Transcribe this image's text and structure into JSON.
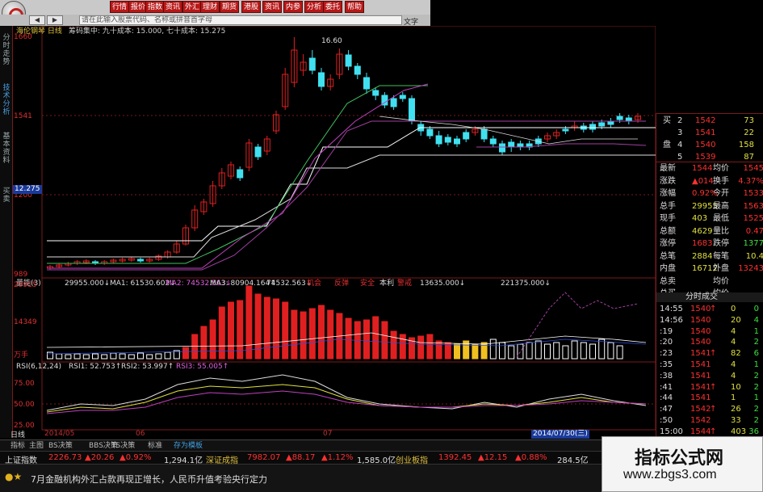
{
  "toolbar": {
    "buttons": [
      "行情",
      "报价",
      "指数",
      "资讯",
      "外汇",
      "理财",
      "期货",
      "港股",
      "资讯",
      "内参",
      "分析",
      "委托",
      "帮助"
    ]
  },
  "searchbar": {
    "input_text": "请在此输入股票代码、名称或拼音首字母",
    "font_label": "文字"
  },
  "sidetabs": [
    "分时走势",
    "技术分析",
    "基本资料",
    "买卖"
  ],
  "chart": {
    "stock_label": "海伦钢琴 日线",
    "cost_text": "筹码集中: 九十成本: 15.000, 七十成本: 15.275",
    "price_axis": [
      "1660",
      "1541",
      "1200",
      "989"
    ],
    "price_marker": "12.275",
    "high_label": "16.60",
    "volume_header": [
      "量能(3)",
      "29955.000↓",
      "MA1: 61530.602↓",
      "MA2: 74532.563↓",
      "MA3: 80904.164↑",
      "74532.563↓",
      "机会",
      "反弹",
      "安全",
      "本利",
      "警戒",
      "13635.000↓",
      "221375.000↓"
    ],
    "volume_axis": [
      "29915",
      "14349",
      "万手"
    ],
    "rsi_header": [
      "RSI(6,12,24)",
      "RSI1: 52.753↑",
      "RSI2: 53.997↑",
      "RSI3: 55.005↑"
    ],
    "rsi_axis": [
      "75.00",
      "50.00",
      "25.00"
    ],
    "x_labels": [
      "2014/05",
      "06",
      "07"
    ],
    "date_box": "2014/07/30(三)",
    "colors": {
      "up": "#e02020",
      "down": "#40e0f0",
      "yellow": "#f0c020",
      "ma_white": "#ffffff",
      "ma_green": "#40c060",
      "ma_magenta": "#c040c0"
    }
  },
  "quote": {
    "bids": [
      {
        "side": "买",
        "level": "2",
        "price": "1542",
        "vol": "73"
      },
      {
        "side": "",
        "level": "3",
        "price": "1541",
        "vol": "22"
      },
      {
        "side": "盘",
        "level": "4",
        "price": "1540",
        "vol": "158"
      },
      {
        "side": "",
        "level": "5",
        "price": "1539",
        "vol": "87"
      }
    ],
    "stats": [
      {
        "k1": "最新",
        "v1": "1544",
        "k2": "均价",
        "v2": "1545"
      },
      {
        "k1": "涨跌",
        "v1": "▲014",
        "k2": "换手",
        "v2": "4.37%"
      },
      {
        "k1": "涨幅",
        "v1": "0.92%",
        "k2": "今开",
        "v2": "1533"
      },
      {
        "k1": "总手",
        "v1": "29955",
        "k2": "最高",
        "v2": "1563"
      },
      {
        "k1": "现手",
        "v1": "403",
        "k2": "最低",
        "v2": "1525"
      },
      {
        "k1": "总额",
        "v1": "4629",
        "k2": "量比",
        "v2": "0.47"
      },
      {
        "k1": "涨停",
        "v1": "1683",
        "k2": "跌停",
        "v2": "1377"
      },
      {
        "k1": "总笔",
        "v1": "2884",
        "k2": "每笔",
        "v2": "10.4"
      },
      {
        "k1": "内盘",
        "v1": "16712",
        "k2": "外盘",
        "v2": "13243"
      },
      {
        "k1": "总卖",
        "v1": "",
        "k2": "均价",
        "v2": ""
      },
      {
        "k1": "总买",
        "v1": "",
        "k2": "均价",
        "v2": ""
      }
    ],
    "tick_header": "分时成交",
    "ticks": [
      {
        "time": "14:55",
        "price": "1540",
        "arrow": "↑",
        "vol": "0",
        "n": "0"
      },
      {
        "time": "14:56",
        "price": "1540",
        "arrow": "",
        "vol": "20",
        "n": "4"
      },
      {
        "time": ":19",
        "price": "1540",
        "arrow": "",
        "vol": "4",
        "n": "1"
      },
      {
        "time": ":20",
        "price": "1540",
        "arrow": "",
        "vol": "4",
        "n": "2"
      },
      {
        "time": ":23",
        "price": "1541",
        "arrow": "↑",
        "vol": "82",
        "n": "6"
      },
      {
        "time": ":35",
        "price": "1541",
        "arrow": "",
        "vol": "4",
        "n": "1"
      },
      {
        "time": ":38",
        "price": "1541",
        "arrow": "",
        "vol": "4",
        "n": "2"
      },
      {
        "time": ":41",
        "price": "1541",
        "arrow": "↑",
        "vol": "10",
        "n": "2"
      },
      {
        "time": ":44",
        "price": "1541",
        "arrow": "",
        "vol": "1",
        "n": "1"
      },
      {
        "time": ":47",
        "price": "1542",
        "arrow": "↑",
        "vol": "26",
        "n": "2"
      },
      {
        "time": ":50",
        "price": "1542",
        "arrow": "",
        "vol": "33",
        "n": "2"
      },
      {
        "time": "15:00",
        "price": "1544",
        "arrow": "↑",
        "vol": "403",
        "n": "36"
      }
    ]
  },
  "bottom_tabs": [
    "日线",
    "指标",
    "主图",
    "BS决策",
    "BBS决策",
    "TS决策",
    "标准",
    "存为模板"
  ],
  "status": {
    "sh_name": "上证指数",
    "sh_val": "2226.73",
    "sh_chg": "▲20.26",
    "sh_pct": "▲0.92%",
    "sh_amt": "1,294.1亿",
    "sz_name": "深证成指",
    "sz_val": "7982.07",
    "sz_chg": "▲88.17",
    "sz_pct": "▲1.12%",
    "sz_amt": "1,585.0亿",
    "cy_name": "创业板指",
    "cy_val": "1392.45",
    "cy_chg": "▲12.15",
    "cy_pct": "▲0.88%",
    "cy_amt": "284.5亿"
  },
  "ticker": {
    "stars": "●★",
    "text": "7月金融机构外汇占款再现正增长，人民币升值考验央行定力"
  },
  "watermark": {
    "line1": "指标公式网",
    "line2": "www.zbgs3.com"
  }
}
